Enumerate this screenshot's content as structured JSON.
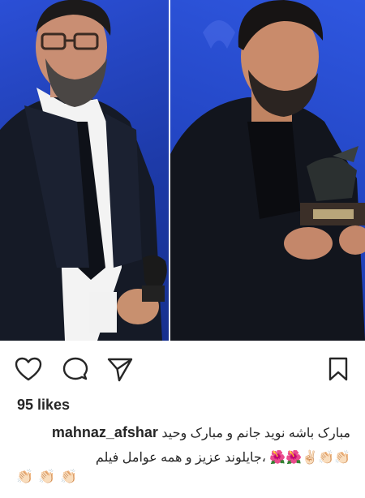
{
  "post": {
    "likes_label": "95 likes",
    "caption": {
      "username": "mahnaz_afshar",
      "line1": "مبارک باشه نوید جانم و مبارک وحید",
      "line2": "👏🏻👏🏻✌🏻🌺🌺 ،جایلوند عزیز و همه عوامل فیلم",
      "line3_emoji": [
        "👏🏻",
        "👏🏻",
        "👏🏻"
      ]
    }
  },
  "icons": [
    "heart-icon",
    "comment-icon",
    "share-icon",
    "bookmark-icon"
  ],
  "colors": {
    "background_blue": "#2346c4",
    "text": "#262626"
  }
}
